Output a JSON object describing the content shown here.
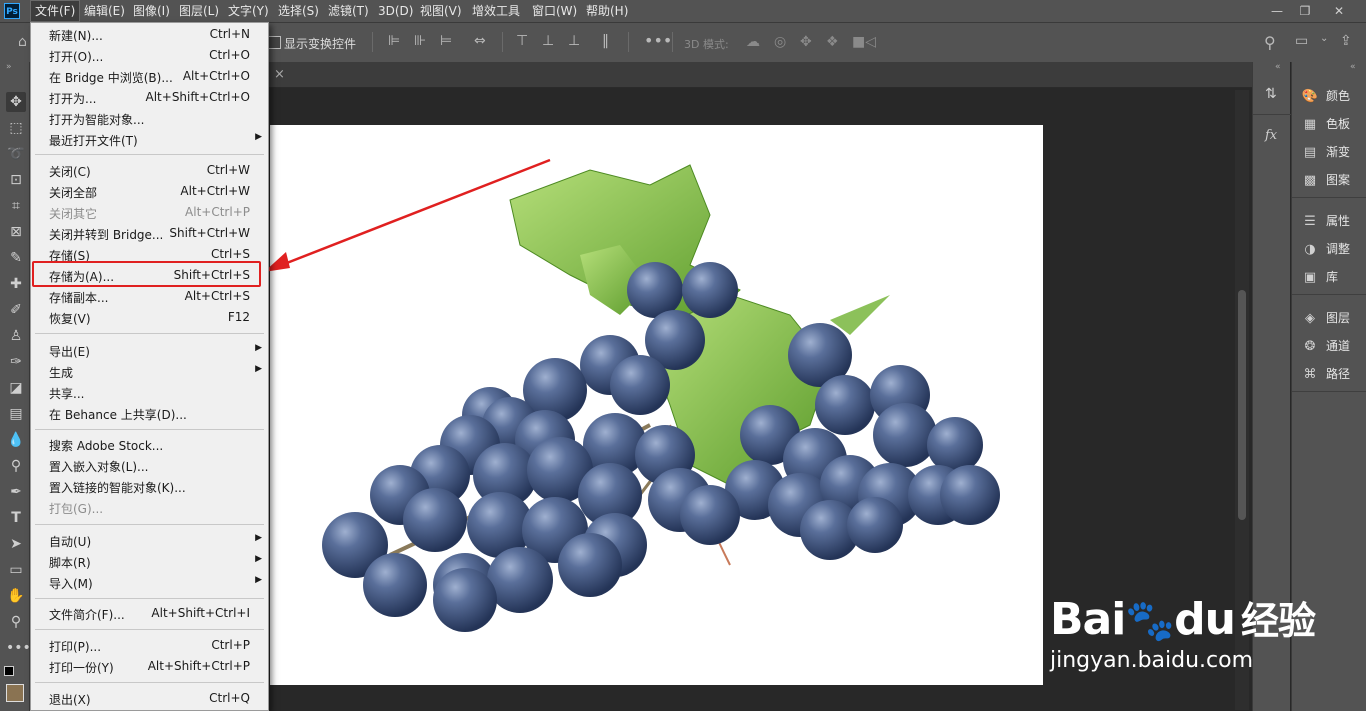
{
  "menubar": {
    "logo": "Ps",
    "items": [
      "文件(F)",
      "编辑(E)",
      "图像(I)",
      "图层(L)",
      "文字(Y)",
      "选择(S)",
      "滤镜(T)",
      "3D(D)",
      "视图(V)",
      "增效工具",
      "窗口(W)",
      "帮助(H)"
    ],
    "window_buttons": [
      "—",
      "❐",
      "✕"
    ]
  },
  "optbar": {
    "transform_label": "显示变换控件",
    "mode3d_label": "3D 模式:"
  },
  "tab": {
    "close": "×"
  },
  "file_menu": {
    "items": [
      {
        "label": "新建(N)...",
        "shortcut": "Ctrl+N"
      },
      {
        "label": "打开(O)...",
        "shortcut": "Ctrl+O"
      },
      {
        "label": "在 Bridge 中浏览(B)...",
        "shortcut": "Alt+Ctrl+O"
      },
      {
        "label": "打开为...",
        "shortcut": "Alt+Shift+Ctrl+O"
      },
      {
        "label": "打开为智能对象...",
        "shortcut": ""
      },
      {
        "label": "最近打开文件(T)",
        "shortcut": "",
        "submenu": true
      },
      {
        "label": "关闭(C)",
        "shortcut": "Ctrl+W"
      },
      {
        "label": "关闭全部",
        "shortcut": "Alt+Ctrl+W"
      },
      {
        "label": "关闭其它",
        "shortcut": "Alt+Ctrl+P",
        "disabled": true
      },
      {
        "label": "关闭并转到 Bridge...",
        "shortcut": "Shift+Ctrl+W"
      },
      {
        "label": "存储(S)",
        "shortcut": "Ctrl+S"
      },
      {
        "label": "存储为(A)...",
        "shortcut": "Shift+Ctrl+S"
      },
      {
        "label": "存储副本...",
        "shortcut": "Alt+Ctrl+S"
      },
      {
        "label": "恢复(V)",
        "shortcut": "F12"
      },
      {
        "label": "导出(E)",
        "shortcut": "",
        "submenu": true
      },
      {
        "label": "生成",
        "shortcut": "",
        "submenu": true
      },
      {
        "label": "共享...",
        "shortcut": ""
      },
      {
        "label": "在 Behance 上共享(D)...",
        "shortcut": ""
      },
      {
        "label": "搜索 Adobe Stock...",
        "shortcut": ""
      },
      {
        "label": "置入嵌入对象(L)...",
        "shortcut": ""
      },
      {
        "label": "置入链接的智能对象(K)...",
        "shortcut": ""
      },
      {
        "label": "打包(G)...",
        "shortcut": "",
        "disabled": true
      },
      {
        "label": "自动(U)",
        "shortcut": "",
        "submenu": true
      },
      {
        "label": "脚本(R)",
        "shortcut": "",
        "submenu": true
      },
      {
        "label": "导入(M)",
        "shortcut": "",
        "submenu": true
      },
      {
        "label": "文件简介(F)...",
        "shortcut": "Alt+Shift+Ctrl+I"
      },
      {
        "label": "打印(P)...",
        "shortcut": "Ctrl+P"
      },
      {
        "label": "打印一份(Y)",
        "shortcut": "Alt+Shift+Ctrl+P"
      },
      {
        "label": "退出(X)",
        "shortcut": "Ctrl+Q"
      }
    ]
  },
  "right_panel": {
    "items": [
      {
        "label": "颜色",
        "icon": "palette-icon"
      },
      {
        "label": "色板",
        "icon": "swatches-icon"
      },
      {
        "label": "渐变",
        "icon": "gradient-icon"
      },
      {
        "label": "图案",
        "icon": "pattern-icon"
      },
      {
        "label": "属性",
        "icon": "properties-icon"
      },
      {
        "label": "调整",
        "icon": "adjustments-icon"
      },
      {
        "label": "库",
        "icon": "libraries-icon"
      },
      {
        "label": "图层",
        "icon": "layers-icon"
      },
      {
        "label": "通道",
        "icon": "channels-icon"
      },
      {
        "label": "路径",
        "icon": "paths-icon"
      }
    ]
  },
  "narrow_panel": {
    "fx": "fx"
  },
  "watermark": {
    "brand": "Bai",
    "brand2": "du",
    "cn": "经验",
    "url": "jingyan.baidu.com"
  },
  "colors": {
    "highlight": "#e02020",
    "arrow": "#e02020"
  }
}
